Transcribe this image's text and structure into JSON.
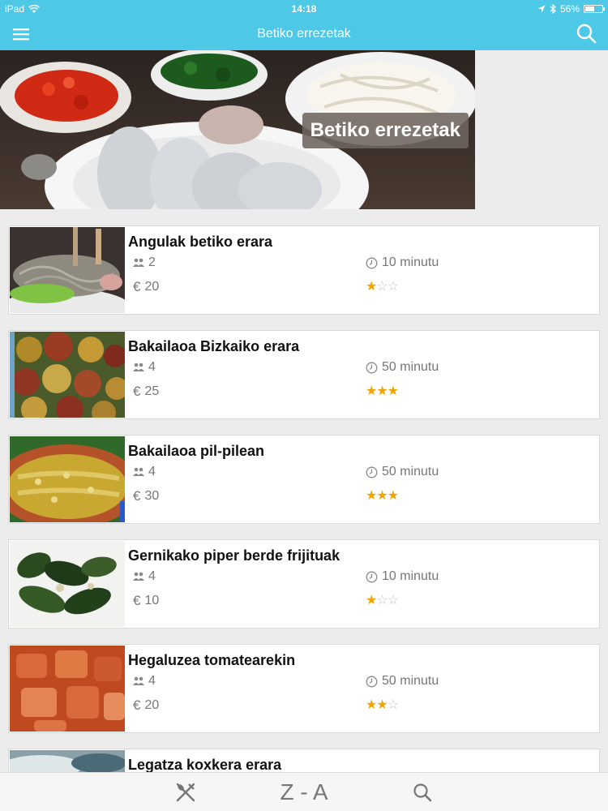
{
  "status_bar": {
    "device": "iPad",
    "time": "14:18",
    "battery": "56%",
    "battery_level": 0.56
  },
  "nav": {
    "title": "Betiko errezetak",
    "menu_icon": "hamburger-menu-icon",
    "search_icon": "search-icon"
  },
  "hero": {
    "title": "Betiko errezetak"
  },
  "recipes": [
    {
      "title": "Angulak betiko erara",
      "people": "2",
      "time": "10 minutu",
      "price": "20",
      "rating": 1,
      "rating_max": 3
    },
    {
      "title": "Bakailaoa Bizkaiko erara",
      "people": "4",
      "time": "50 minutu",
      "price": "25",
      "rating": 3,
      "rating_max": 3
    },
    {
      "title": "Bakailaoa pil-pilean",
      "people": "4",
      "time": "50 minutu",
      "price": "30",
      "rating": 3,
      "rating_max": 3
    },
    {
      "title": "Gernikako piper berde frijituak",
      "people": "4",
      "time": "10 minutu",
      "price": "10",
      "rating": 1,
      "rating_max": 3
    },
    {
      "title": "Hegaluzea tomatearekin",
      "people": "4",
      "time": "50 minutu",
      "price": "20",
      "rating": 2,
      "rating_max": 3
    },
    {
      "title": "Legatza koxkera erara",
      "people": "",
      "time": "",
      "price": "",
      "rating": 0,
      "rating_max": 3
    }
  ],
  "currency_symbol": "€",
  "tab_bar": {
    "sort_label": "Z - A",
    "recipes_icon": "fork-knife-icon",
    "search_icon": "search-icon"
  },
  "colors": {
    "accent": "#4dc8e6",
    "star": "#f0a400"
  }
}
